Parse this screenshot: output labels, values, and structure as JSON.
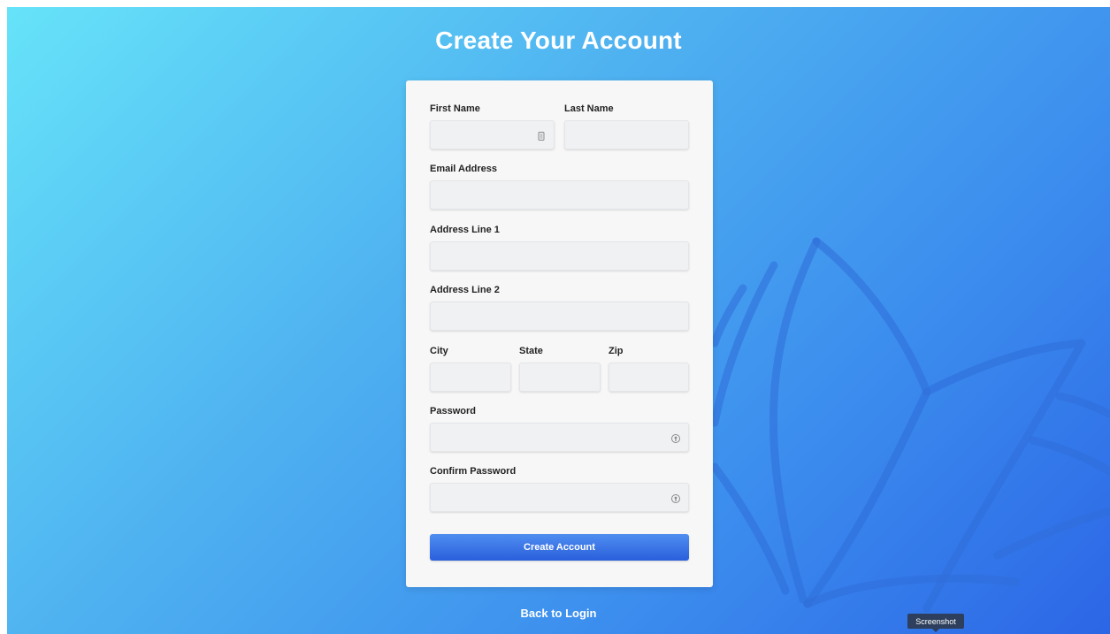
{
  "page": {
    "title": "Create Your Account",
    "back_link": "Back to Login"
  },
  "form": {
    "first_name": {
      "label": "First Name",
      "value": "",
      "icon": "contact-card-icon"
    },
    "last_name": {
      "label": "Last Name",
      "value": ""
    },
    "email": {
      "label": "Email Address",
      "value": ""
    },
    "address1": {
      "label": "Address Line 1",
      "value": ""
    },
    "address2": {
      "label": "Address Line 2",
      "value": ""
    },
    "city": {
      "label": "City",
      "value": ""
    },
    "state": {
      "label": "State",
      "value": ""
    },
    "zip": {
      "label": "Zip",
      "value": ""
    },
    "password": {
      "label": "Password",
      "value": "",
      "icon": "password-key-icon"
    },
    "confirm_password": {
      "label": "Confirm Password",
      "value": "",
      "icon": "password-key-icon"
    },
    "submit_label": "Create Account"
  },
  "tooltip": {
    "text": "Screenshot"
  },
  "colors": {
    "gradient_start": "#66e3f9",
    "gradient_end": "#2c66e6",
    "button": "#3a74e6",
    "tooltip_bg": "#2d3f5c"
  }
}
